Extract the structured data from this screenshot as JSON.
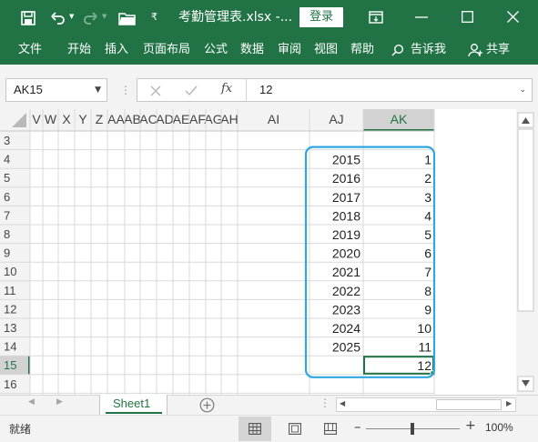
{
  "titlebar": {
    "filename": "考勤管理表.xlsx  -...",
    "login_label": "登录",
    "colors": {
      "bar": "#217346"
    }
  },
  "ribbon": {
    "tabs": [
      "文件",
      "开始",
      "插入",
      "页面布局",
      "公式",
      "数据",
      "审阅",
      "视图",
      "帮助"
    ],
    "tell_me": "告诉我",
    "share": "共享"
  },
  "formula_bar": {
    "name_box": "AK15",
    "fx_label": "fx",
    "value": "12"
  },
  "grid": {
    "columns": [
      "V",
      "W",
      "X",
      "Y",
      "Z",
      "AA",
      "AB",
      "AC",
      "AD",
      "AE",
      "AF",
      "AG",
      "AH",
      "AI",
      "AJ",
      "AK"
    ],
    "selected_column": "AK",
    "rows": [
      "3",
      "4",
      "5",
      "6",
      "7",
      "8",
      "9",
      "10",
      "11",
      "12",
      "13",
      "14",
      "15",
      "16"
    ],
    "selected_row": "15",
    "data": [
      {
        "row": "4",
        "aj": "2015",
        "ak": "1"
      },
      {
        "row": "5",
        "aj": "2016",
        "ak": "2"
      },
      {
        "row": "6",
        "aj": "2017",
        "ak": "3"
      },
      {
        "row": "7",
        "aj": "2018",
        "ak": "4"
      },
      {
        "row": "8",
        "aj": "2019",
        "ak": "5"
      },
      {
        "row": "9",
        "aj": "2020",
        "ak": "6"
      },
      {
        "row": "10",
        "aj": "2021",
        "ak": "7"
      },
      {
        "row": "11",
        "aj": "2022",
        "ak": "8"
      },
      {
        "row": "12",
        "aj": "2023",
        "ak": "9"
      },
      {
        "row": "13",
        "aj": "2024",
        "ak": "10"
      },
      {
        "row": "14",
        "aj": "2025",
        "ak": "11"
      },
      {
        "row": "15",
        "aj": "",
        "ak": "12"
      }
    ],
    "active_cell": "AK15",
    "highlight_color": "#2fa8e0"
  },
  "sheets": {
    "tabs": [
      "Sheet1"
    ],
    "active": "Sheet1"
  },
  "status": {
    "mode": "就绪",
    "zoom": "100%"
  }
}
